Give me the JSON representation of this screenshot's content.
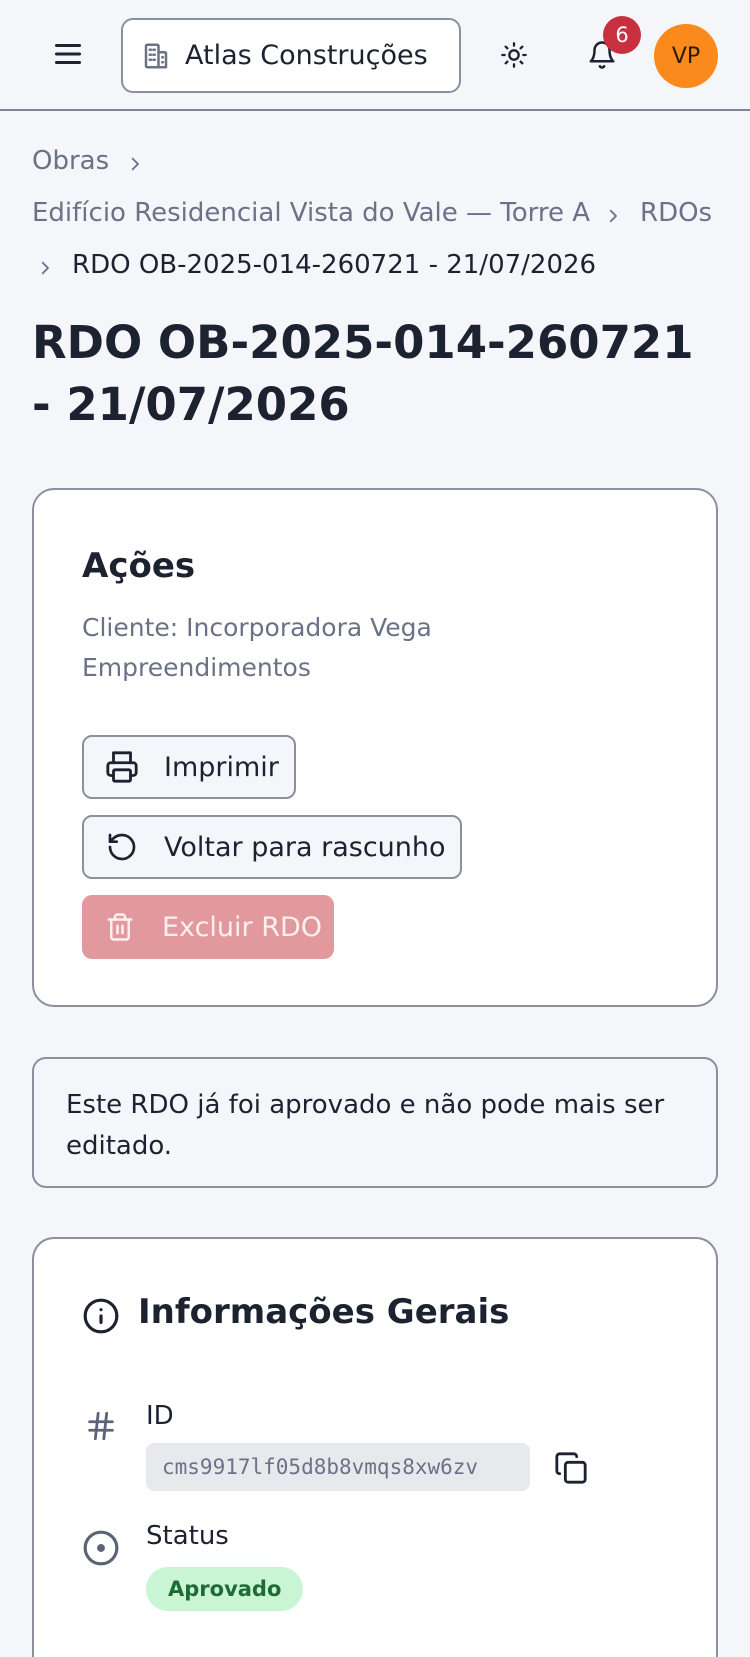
{
  "header": {
    "company": "Atlas Construções",
    "notifications_count": "6",
    "avatar_initials": "VP"
  },
  "breadcrumb": {
    "items": [
      "Obras",
      "Edifício Residencial Vista do Vale — Torre A",
      "RDOs"
    ],
    "current": "RDO OB-2025-014-260721 - 21/07/2026"
  },
  "page": {
    "title": "RDO OB-2025-014-260721 - 21/07/2026"
  },
  "actions": {
    "title": "Ações",
    "client": "Cliente: Incorporadora Vega Empreendimentos",
    "print_label": "Imprimir",
    "draft_label": "Voltar para rascunho",
    "delete_label": "Excluir RDO"
  },
  "notice": {
    "text": "Este RDO já foi aprovado e não pode mais ser editado."
  },
  "info": {
    "title": "Informações Gerais",
    "id_label": "ID",
    "id_value": "cms9917lf05d8b8vmqs8xw6zv",
    "status_label": "Status",
    "status_value": "Aprovado"
  },
  "colors": {
    "accent_badge": "#c8303f",
    "avatar": "#fb8a1c",
    "danger_disabled": "#e2999d",
    "status_success_bg": "#c9f5d4",
    "status_success_text": "#1f6b35"
  },
  "icons": [
    "menu-icon",
    "building-icon",
    "sun-icon",
    "bell-icon",
    "chevron-right-icon",
    "printer-icon",
    "rotate-ccw-icon",
    "trash-icon",
    "info-icon",
    "hash-icon",
    "copy-icon",
    "circle-dot-icon"
  ]
}
